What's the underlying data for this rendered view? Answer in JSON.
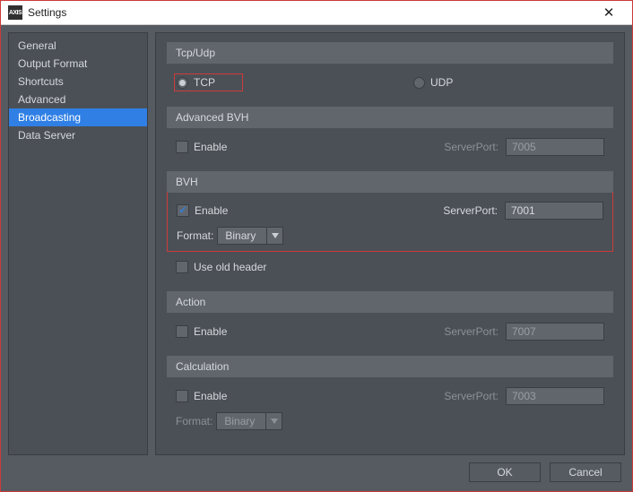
{
  "window": {
    "title": "Settings",
    "app_icon_text": "AXIS"
  },
  "sidebar": {
    "items": [
      {
        "label": "General"
      },
      {
        "label": "Output Format"
      },
      {
        "label": "Shortcuts"
      },
      {
        "label": "Advanced"
      },
      {
        "label": "Broadcasting",
        "selected": true
      },
      {
        "label": "Data Server"
      }
    ]
  },
  "sections": {
    "tcpudp": {
      "title": "Tcp/Udp",
      "tcp_label": "TCP",
      "udp_label": "UDP",
      "selected": "tcp"
    },
    "advanced_bvh": {
      "title": "Advanced BVH",
      "enable_label": "Enable",
      "enabled": false,
      "port_label": "ServerPort:",
      "port_value": "7005"
    },
    "bvh": {
      "title": "BVH",
      "enable_label": "Enable",
      "enabled": true,
      "port_label": "ServerPort:",
      "port_value": "7001",
      "format_label": "Format:",
      "format_value": "Binary",
      "use_old_header_label": "Use old header",
      "use_old_header": false
    },
    "action": {
      "title": "Action",
      "enable_label": "Enable",
      "enabled": false,
      "port_label": "ServerPort:",
      "port_value": "7007"
    },
    "calculation": {
      "title": "Calculation",
      "enable_label": "Enable",
      "enabled": false,
      "port_label": "ServerPort:",
      "port_value": "7003",
      "format_label": "Format:",
      "format_value": "Binary"
    }
  },
  "footer": {
    "ok_label": "OK",
    "cancel_label": "Cancel"
  }
}
